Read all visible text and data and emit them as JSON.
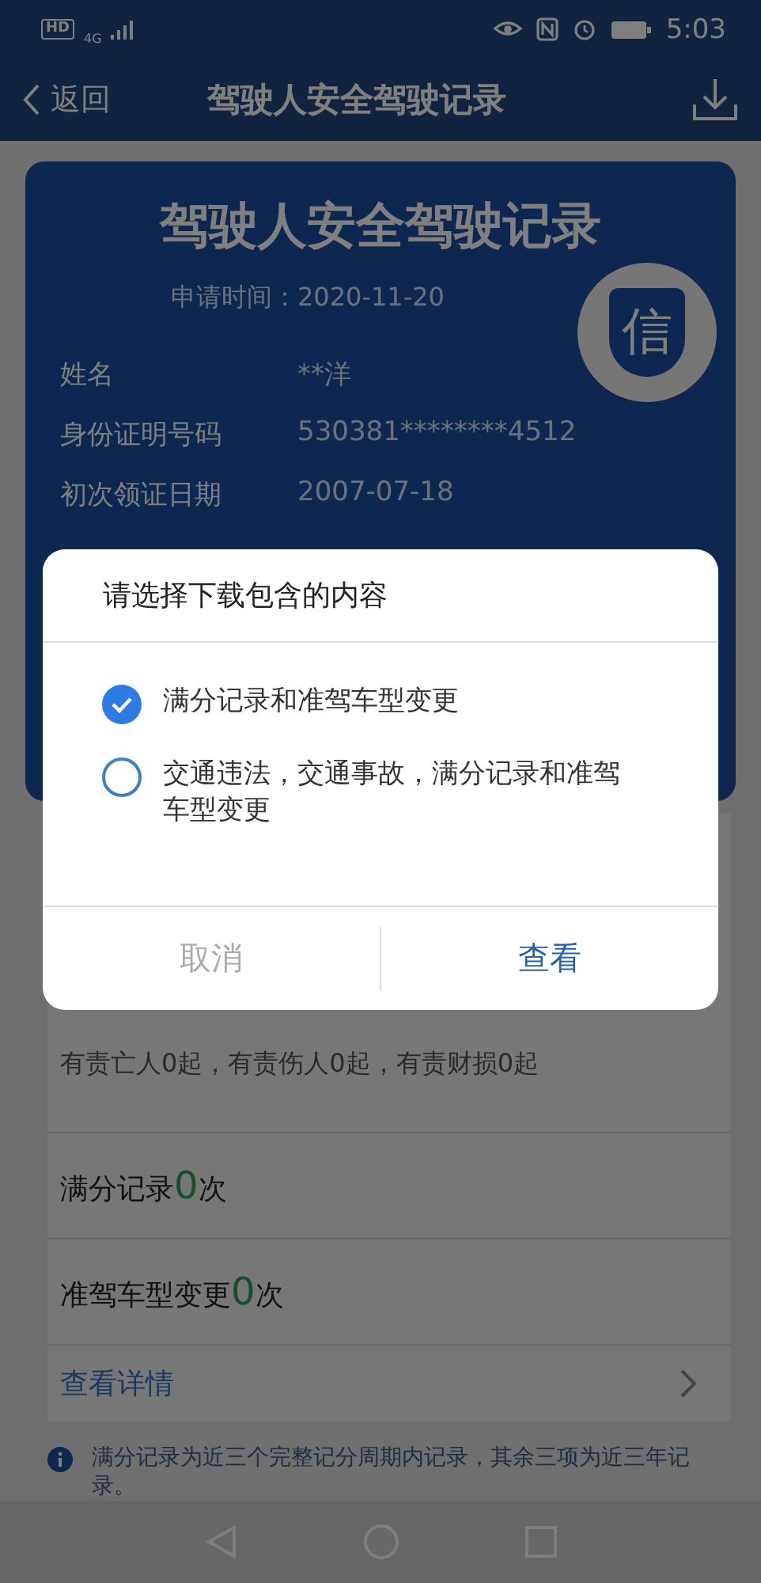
{
  "status_bar": {
    "network_badge": "HD",
    "network_type": "4G",
    "time": "5:03"
  },
  "nav_bar": {
    "back": "返回",
    "title": "驾驶人安全驾驶记录"
  },
  "certificate": {
    "title": "驾驶人安全驾驶记录",
    "applied": "申请时间：2020-11-20",
    "seal": "信",
    "fields": [
      {
        "label": "姓名",
        "value": "**洋"
      },
      {
        "label": "身份证明号码",
        "value": "530381********4512"
      },
      {
        "label": "初次领证日期",
        "value": "2007-07-18"
      }
    ]
  },
  "records": [
    {
      "detail": "有责亡人0起，有责伤人0起，有责财损0起"
    },
    {
      "title": "满分记录",
      "count": "0",
      "unit": "次"
    },
    {
      "title": "准驾车型变更",
      "count": "0",
      "unit": "次"
    }
  ],
  "details_link": "查看详情",
  "note": "满分记录为近三个完整记分周期内记录，其余三项为近三年记录。",
  "dialog": {
    "title": "请选择下载包含的内容",
    "options": [
      {
        "label": "满分记录和准驾车型变更",
        "selected": true
      },
      {
        "label": "交通违法，交通事故，满分记录和准驾车型变更",
        "selected": false
      }
    ],
    "buttons": [
      {
        "label": "取消",
        "kind": "cancel"
      },
      {
        "label": "查看",
        "kind": "confirm"
      }
    ]
  }
}
